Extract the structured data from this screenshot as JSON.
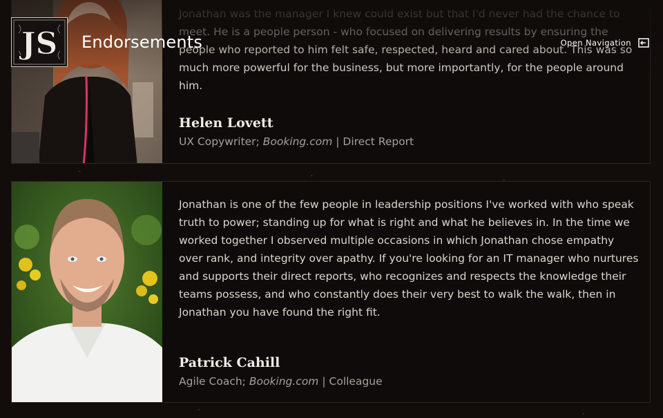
{
  "header": {
    "logo_text": "JS",
    "section_title": "Endorsements",
    "nav_label": "Open Navigation",
    "nav_icon": "exit-door-icon"
  },
  "endorsements": [
    {
      "quote": "Jonathan was the manager I knew could exist but that I'd never had the chance to meet. He is a people person - who focused on delivering results by ensuring the people who reported to him felt safe, respected, heard and cared about. This was so much more powerful for the business, but more importantly, for the people around him.",
      "name": "Helen Lovett",
      "title": "UX Copywriter;",
      "company": "Booking.com",
      "separator": "|",
      "relationship": "Direct Report",
      "photo": "portrait of woman with red hair in black coat"
    },
    {
      "quote": "Jonathan is one of the few people in leadership positions I've worked with who speak truth to power; standing up for what is right and what he believes in. In the time we worked together I observed multiple occasions in which Jonathan chose empathy over rank, and integrity over apathy. If you're looking for an IT manager who nurtures and supports their direct reports, who recognizes and respects the knowledge their teams possess, and who constantly does their very best to walk the walk, then in Jonathan you have found the right fit.",
      "name": "Patrick Cahill",
      "title": "Agile Coach;",
      "company": "Booking.com",
      "separator": "|",
      "relationship": "Colleague",
      "photo": "smiling man in white shirt with foliage background"
    }
  ],
  "colors": {
    "background": "#120d0b",
    "card": "#0f0b0a",
    "text": "#ddd6cf",
    "muted": "#a8a09a"
  }
}
